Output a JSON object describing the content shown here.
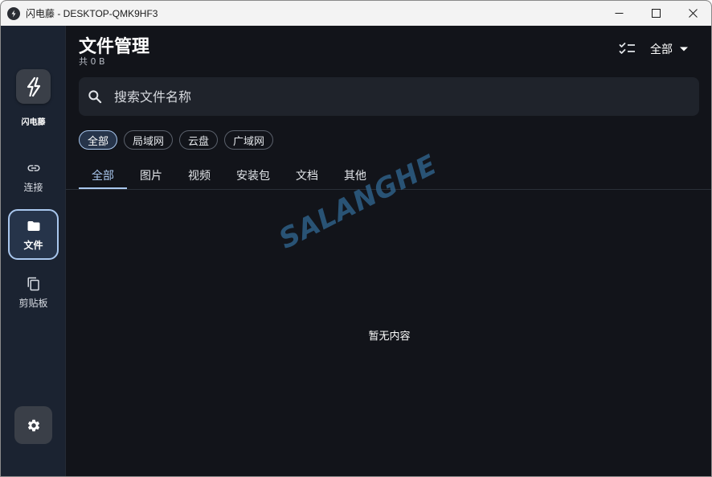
{
  "window": {
    "title": "闪电藤 - DESKTOP-QMK9HF3"
  },
  "sidebar": {
    "app_name": "闪电藤",
    "items": [
      {
        "label": "连接",
        "icon": "link-icon",
        "active": false
      },
      {
        "label": "文件",
        "icon": "folder-icon",
        "active": true
      },
      {
        "label": "剪贴板",
        "icon": "clipboard-copy-icon",
        "active": false
      }
    ],
    "settings_icon": "gear-icon"
  },
  "header": {
    "title": "文件管理",
    "subtitle": "共 0 B",
    "filter_label": "全部"
  },
  "search": {
    "placeholder": "搜索文件名称"
  },
  "chips": [
    {
      "label": "全部",
      "active": true
    },
    {
      "label": "局域网",
      "active": false
    },
    {
      "label": "云盘",
      "active": false
    },
    {
      "label": "广域网",
      "active": false
    }
  ],
  "tabs": [
    {
      "label": "全部",
      "active": true
    },
    {
      "label": "图片",
      "active": false
    },
    {
      "label": "视频",
      "active": false
    },
    {
      "label": "安装包",
      "active": false
    },
    {
      "label": "文档",
      "active": false
    },
    {
      "label": "其他",
      "active": false
    }
  ],
  "empty_state": {
    "text": "暂无内容"
  },
  "watermark": {
    "text": "SALANGHE"
  },
  "colors": {
    "accent": "#a9c7ee",
    "background": "#12141a",
    "sidebar": "#1b2331"
  }
}
